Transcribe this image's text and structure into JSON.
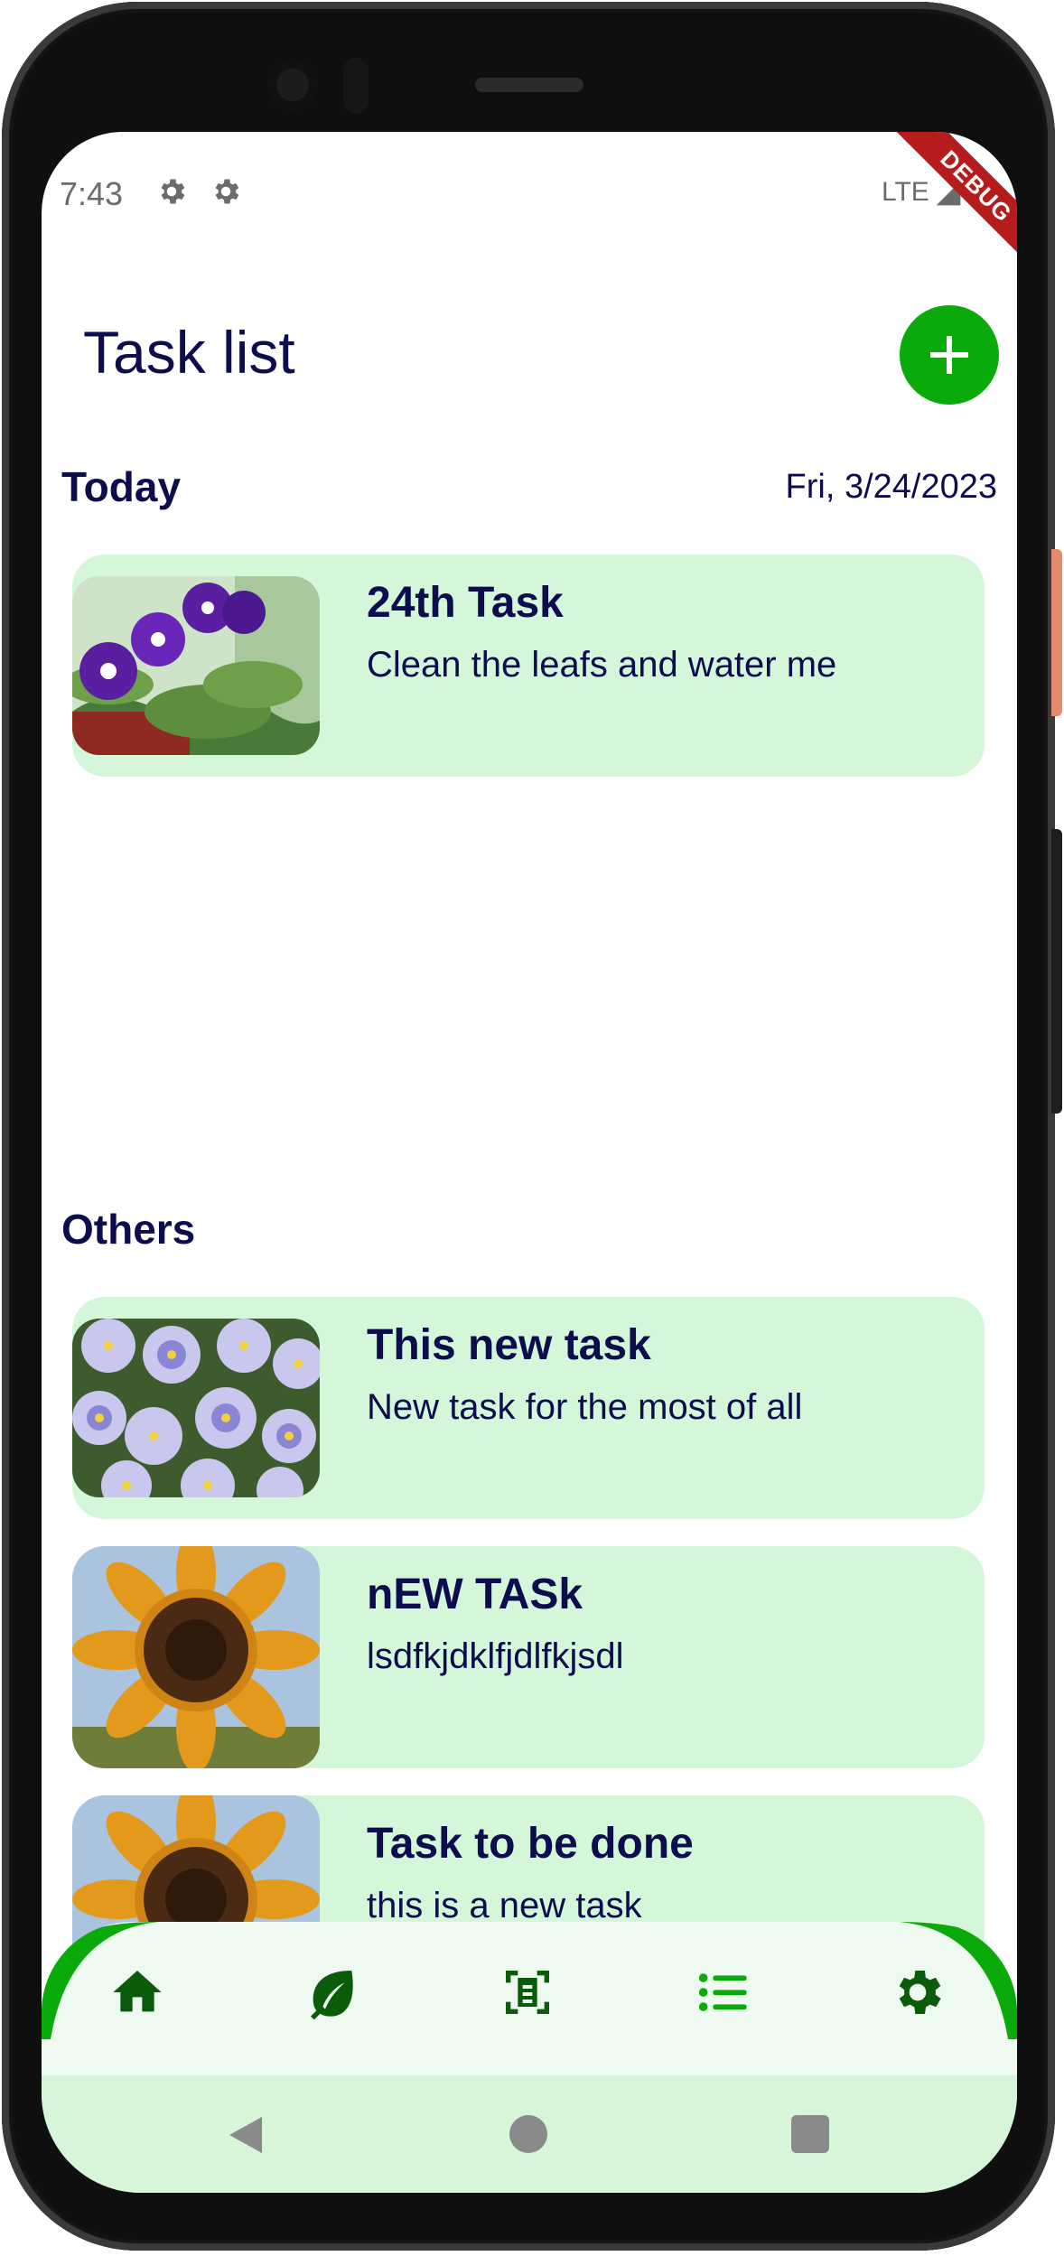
{
  "status_bar": {
    "time": "7:43",
    "network": "LTE",
    "debug_banner": "DEBUG"
  },
  "header": {
    "title": "Task list"
  },
  "today": {
    "title": "Today",
    "date": "Fri, 3/24/2023",
    "tasks": [
      {
        "title": "24th Task",
        "description": "Clean the leafs and water me",
        "image": "purple-violet-plant"
      }
    ]
  },
  "others": {
    "title": "Others",
    "tasks": [
      {
        "title": "This new task",
        "description": "New task for the most of all",
        "image": "pansy-flowers"
      },
      {
        "title": "nEW TASk",
        "description": "lsdfkjdklfjdlfkjsdl",
        "image": "sunflower"
      },
      {
        "title": "Task to be done",
        "description": "this is a new task",
        "image": "sunflower"
      }
    ]
  },
  "bottom_nav": {
    "items": [
      "home-icon",
      "leaf-icon",
      "scan-document-icon",
      "list-icon",
      "settings-icon"
    ],
    "active_color": "#0a5c0a",
    "accent": "#0aaa0a"
  },
  "colors": {
    "card_bg": "#d4f7da",
    "text": "#0d0d4d",
    "fab": "#0aaa0a"
  }
}
